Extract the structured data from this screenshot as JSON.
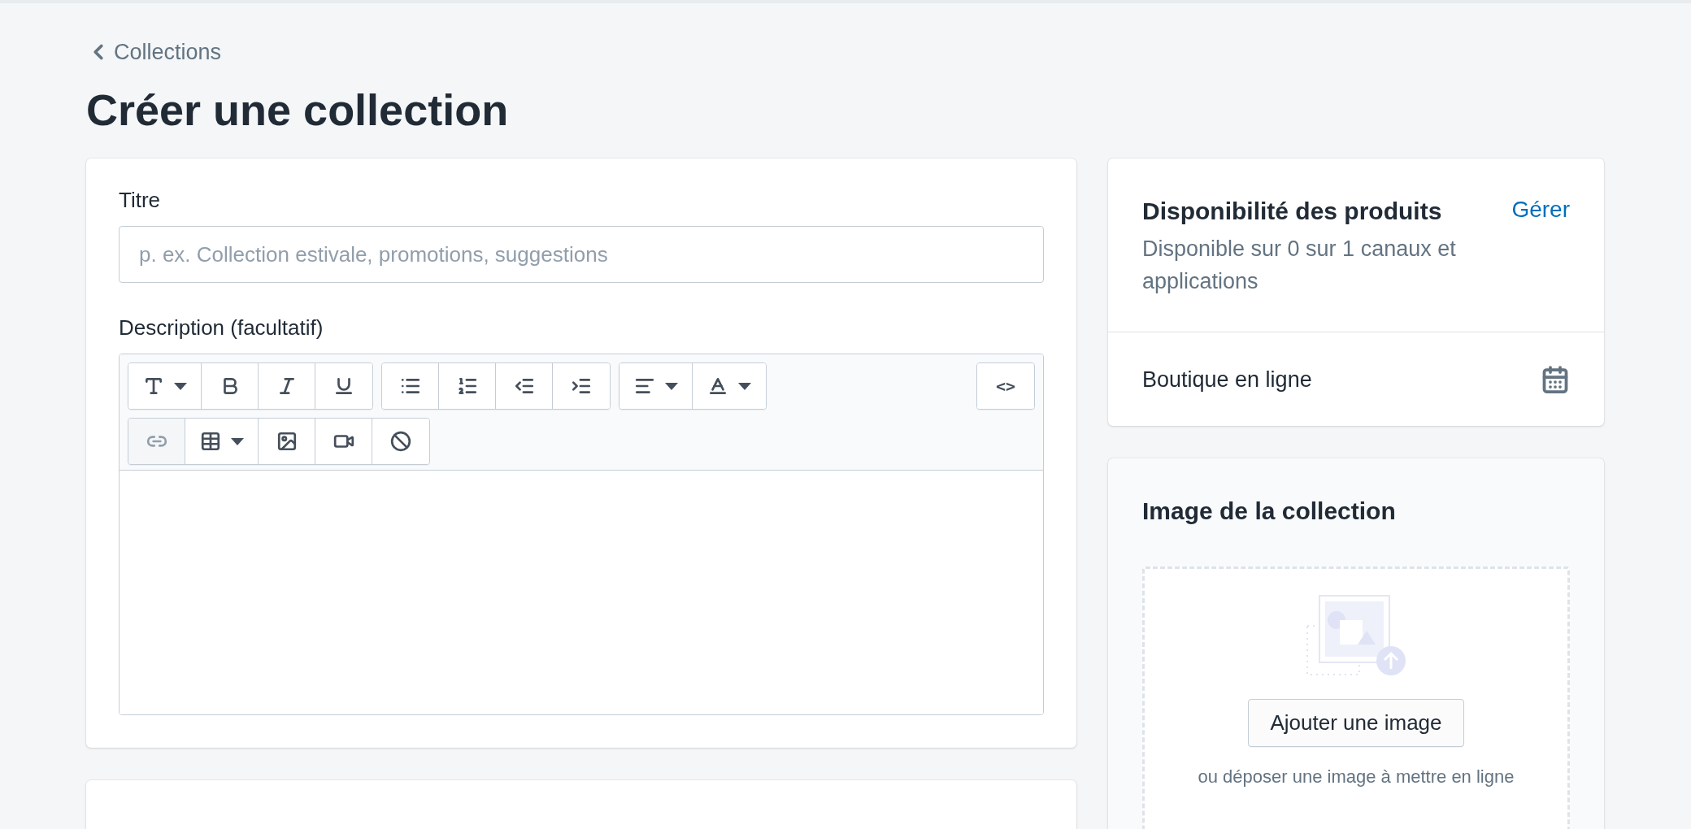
{
  "back_link": {
    "label": "Collections"
  },
  "page_title": "Créer une collection",
  "details_card": {
    "title_field": {
      "label": "Titre",
      "placeholder": "p. ex. Collection estivale, promotions, suggestions"
    },
    "description": {
      "label": "Description (facultatif)",
      "toolbar": {
        "rows": [
          {
            "groups": [
              [
                {
                  "kind": "font",
                  "disabled": false
                },
                {
                  "kind": "bold",
                  "disabled": false
                },
                {
                  "kind": "italic",
                  "disabled": false
                },
                {
                  "kind": "underline",
                  "disabled": false
                }
              ],
              [
                {
                  "kind": "bullets",
                  "disabled": false
                },
                {
                  "kind": "numbers",
                  "disabled": false
                },
                {
                  "kind": "outdent",
                  "disabled": false
                },
                {
                  "kind": "indent",
                  "disabled": false
                }
              ],
              [
                {
                  "kind": "align",
                  "disabled": false
                },
                {
                  "kind": "color",
                  "disabled": false
                }
              ]
            ],
            "trailing": [
              {
                "kind": "code",
                "label": "<>",
                "disabled": false
              }
            ]
          },
          {
            "groups": [
              [
                {
                  "kind": "link",
                  "disabled": true
                },
                {
                  "kind": "table",
                  "disabled": false
                },
                {
                  "kind": "image",
                  "disabled": false
                },
                {
                  "kind": "video",
                  "disabled": false
                },
                {
                  "kind": "clear",
                  "disabled": false
                }
              ]
            ]
          }
        ]
      }
    }
  },
  "availability_card": {
    "title": "Disponibilité des produits",
    "manage_link": "Gérer",
    "summary": "Disponible sur 0 sur 1 canaux et applications",
    "channels": [
      {
        "name": "Boutique en ligne"
      }
    ]
  },
  "image_card": {
    "title": "Image de la collection",
    "add_button": "Ajouter une image",
    "drop_hint": "ou déposer une image à mettre en ligne"
  }
}
